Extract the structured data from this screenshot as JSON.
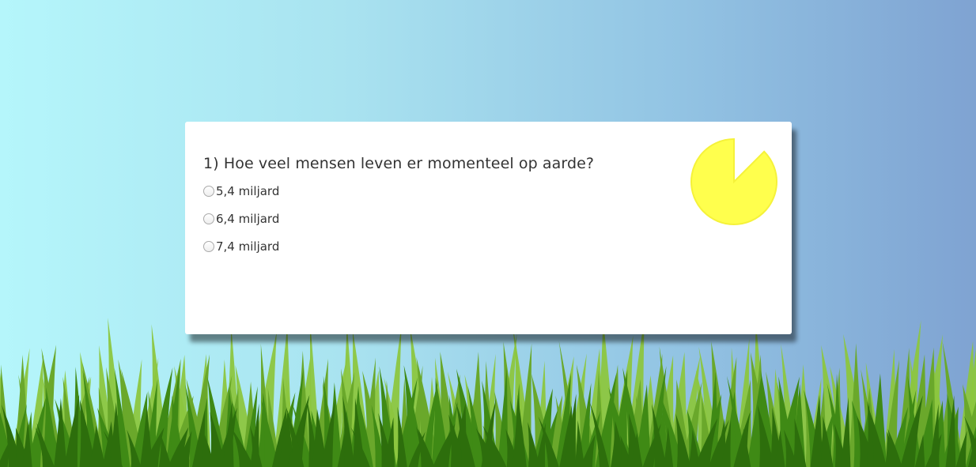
{
  "quiz": {
    "question": "1) Hoe veel mensen leven er momenteel op aarde?",
    "options": [
      {
        "label": "5,4 miljard"
      },
      {
        "label": "6,4 miljard"
      },
      {
        "label": "7,4 miljard"
      }
    ],
    "timer": {
      "remaining_fraction": 0.875,
      "fill_color": "#ffff4d",
      "edge_color": "#f5f23a"
    }
  },
  "colors": {
    "sky_left": "#b5f6fb",
    "sky_right": "#7fa3d2",
    "grass_light": "#8cc63f",
    "grass_dark": "#2d6e0c"
  }
}
